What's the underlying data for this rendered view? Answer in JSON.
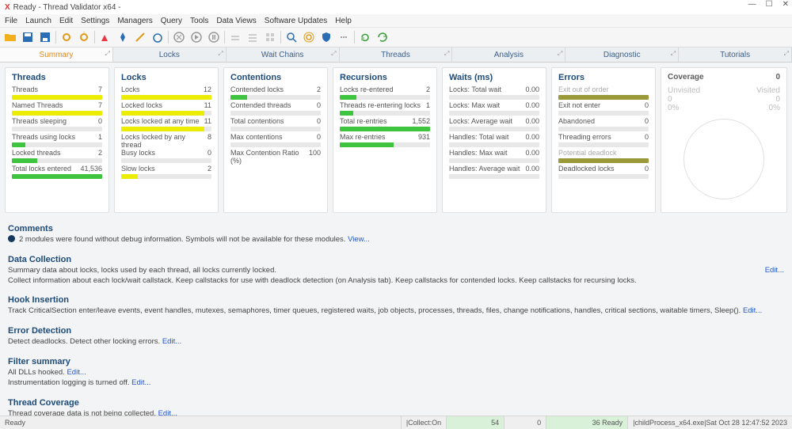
{
  "window": {
    "title": "Ready - Thread Validator x64 -"
  },
  "menu": [
    "File",
    "Launch",
    "Edit",
    "Settings",
    "Managers",
    "Query",
    "Tools",
    "Data Views",
    "Software Updates",
    "Help"
  ],
  "tabs": [
    "Summary",
    "Locks",
    "Wait Chains",
    "Threads",
    "Analysis",
    "Diagnostic",
    "Tutorials"
  ],
  "cards": {
    "threads": {
      "title": "Threads",
      "rows": [
        {
          "label": "Threads",
          "value": "7",
          "fill": 100,
          "color": "#ecec00"
        },
        {
          "label": "Named Threads",
          "value": "7",
          "fill": 100,
          "color": "#ecec00"
        },
        {
          "label": "Threads sleeping",
          "value": "0",
          "fill": 0,
          "color": "#ecec00"
        },
        {
          "label": "Threads using locks",
          "value": "1",
          "fill": 15,
          "color": "#3fc43f"
        },
        {
          "label": "Locked threads",
          "value": "2",
          "fill": 28,
          "color": "#3fc43f"
        },
        {
          "label": "Total locks entered",
          "value": "41,536",
          "fill": 100,
          "color": "#3fc43f"
        }
      ]
    },
    "locks": {
      "title": "Locks",
      "rows": [
        {
          "label": "Locks",
          "value": "12",
          "fill": 100,
          "color": "#ecec00"
        },
        {
          "label": "Locked locks",
          "value": "11",
          "fill": 92,
          "color": "#ecec00"
        },
        {
          "label": "Locks locked at any time",
          "value": "11",
          "fill": 92,
          "color": "#ecec00"
        },
        {
          "label": "Locks locked by any thread",
          "value": "8",
          "fill": 67,
          "color": "#3fc43f"
        },
        {
          "label": "Busy locks",
          "value": "0",
          "fill": 0,
          "color": "#ecec00"
        },
        {
          "label": "Slow locks",
          "value": "2",
          "fill": 18,
          "color": "#ecec00"
        }
      ]
    },
    "contentions": {
      "title": "Contentions",
      "rows": [
        {
          "label": "Contended locks",
          "value": "2",
          "fill": 18,
          "color": "#3fc43f"
        },
        {
          "label": "Contended threads",
          "value": "0",
          "fill": 0,
          "color": "#ecec00"
        },
        {
          "label": "Total contentions",
          "value": "0",
          "fill": 0,
          "color": "#ecec00"
        },
        {
          "label": "Max contentions",
          "value": "0",
          "fill": 0,
          "color": "#ecec00"
        },
        {
          "label": "Max Contention Ratio (%)",
          "value": "100",
          "fill": 100,
          "color": "#3fc43f"
        }
      ]
    },
    "recursions": {
      "title": "Recursions",
      "rows": [
        {
          "label": "Locks re-entered",
          "value": "2",
          "fill": 18,
          "color": "#3fc43f"
        },
        {
          "label": "Threads re-entering locks",
          "value": "1",
          "fill": 15,
          "color": "#3fc43f"
        },
        {
          "label": "Total re-entries",
          "value": "1,552",
          "fill": 100,
          "color": "#3fc43f"
        },
        {
          "label": "Max re-entries",
          "value": "931",
          "fill": 60,
          "color": "#3fc43f"
        }
      ]
    },
    "waits": {
      "title": "Waits (ms)",
      "rows": [
        {
          "label": "Locks: Total wait",
          "value": "0.00",
          "fill": 0,
          "color": "#ecec00"
        },
        {
          "label": "Locks: Max wait",
          "value": "0.00",
          "fill": 0,
          "color": "#ecec00"
        },
        {
          "label": "Locks: Average wait",
          "value": "0.00",
          "fill": 0,
          "color": "#ecec00"
        },
        {
          "label": "Handles: Total wait",
          "value": "0.00",
          "fill": 0,
          "color": "#ecec00"
        },
        {
          "label": "Handles: Max wait",
          "value": "0.00",
          "fill": 0,
          "color": "#ecec00"
        },
        {
          "label": "Handles: Average wait",
          "value": "0.00",
          "fill": 0,
          "color": "#ecec00"
        }
      ]
    },
    "errors": {
      "title": "Errors",
      "rows": [
        {
          "label": "Exit out of order",
          "value": "",
          "fill": 100,
          "color": "#9a9a3a",
          "dim": true
        },
        {
          "label": "Exit not enter",
          "value": "0",
          "fill": 0,
          "color": "#ecec00"
        },
        {
          "label": "Abandoned",
          "value": "0",
          "fill": 0,
          "color": "#ecec00"
        },
        {
          "label": "Threading errors",
          "value": "0",
          "fill": 0,
          "color": "#ecec00"
        },
        {
          "label": "Potential deadlock",
          "value": "",
          "fill": 100,
          "color": "#9a9a3a",
          "dim": true
        },
        {
          "label": "Deadlocked locks",
          "value": "0",
          "fill": 0,
          "color": "#ecec00"
        }
      ]
    },
    "coverage": {
      "title": "Coverage",
      "total": "0",
      "unvisited_label": "Unvisited",
      "unvisited_count": "0",
      "unvisited_pct": "0%",
      "visited_label": "Visited",
      "visited_count": "0",
      "visited_pct": "0%"
    }
  },
  "sections": {
    "comments": {
      "title": "Comments",
      "body": "2 modules were found without debug information. Symbols will not be available for these modules.",
      "link": "View..."
    },
    "data_collection": {
      "title": "Data Collection",
      "body1": "Summary data about locks, locks used by each thread, all locks currently locked.",
      "body2": "Collect information about each lock/wait callstack. Keep callstacks for use with deadlock detection (on Analysis tab). Keep callstacks for contended locks. Keep callstacks for recursing locks.",
      "link": "Edit..."
    },
    "hook": {
      "title": "Hook Insertion",
      "body": "Track CriticalSection enter/leave events, event handles, mutexes, semaphores, timer queues, registered waits, job objects, processes, threads, files, change notifications, handles, critical sections, waitable timers, Sleep().",
      "link": "Edit..."
    },
    "error_detection": {
      "title": "Error Detection",
      "body": "Detect deadlocks. Detect other locking errors.",
      "link": "Edit..."
    },
    "filter": {
      "title": "Filter summary",
      "body1": "All DLLs hooked.",
      "link1": "Edit...",
      "body2": "Instrumentation logging is turned off.",
      "link2": "Edit..."
    },
    "coverage": {
      "title": "Thread Coverage",
      "body": "Thread coverage data is not being collected.",
      "link": "Edit..."
    }
  },
  "statusbar": {
    "ready": "Ready",
    "collect": "|Collect:On",
    "n1": "54",
    "n2": "0",
    "n3": "36 Ready",
    "proc": "|childProcess_x64.exe|Sat Oct 28 12:47:52 2023"
  }
}
